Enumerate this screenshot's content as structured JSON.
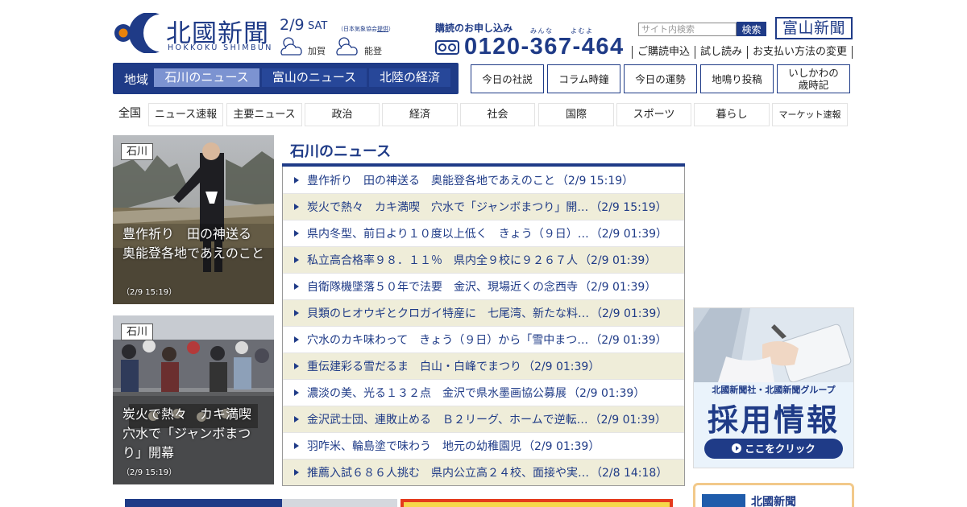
{
  "header": {
    "logo_text": "北國新聞",
    "logo_sub": "HOKKOKU SHIMBUN",
    "weather": {
      "date": "2/9",
      "day": "SAT",
      "source_prefix": "（日本気象協会",
      "source_link": "提供",
      "source_suffix": "）",
      "areas": [
        {
          "label": "加賀",
          "icon": "cloud-sun-icon"
        },
        {
          "label": "能登",
          "icon": "cloud-sun-icon"
        }
      ]
    },
    "subscribe": {
      "title": "購読のお申し込み",
      "phone": "0120-367-464",
      "ruby_minna": "みんな",
      "ruby_yoi": "よむよ"
    },
    "search": {
      "placeholder": "サイト内検索",
      "button": "検索"
    },
    "toyama_logo": "富山新聞",
    "links": [
      "ご購読申込",
      "試し読み",
      "お支払い方法の変更"
    ]
  },
  "region_nav": {
    "label": "地域",
    "tabs": [
      "石川のニュース",
      "富山のニュース",
      "北陸の経済"
    ],
    "active_index": 0
  },
  "box_nav": [
    {
      "label": "今日の社説"
    },
    {
      "label": "コラム時鐘"
    },
    {
      "label": "今日の運勢"
    },
    {
      "label": "地鳴り投稿"
    },
    {
      "label": "いしかわの\n歳時記"
    }
  ],
  "category_nav": {
    "first": "全国",
    "items": [
      "ニュース速報",
      "主要ニュース",
      "政治",
      "経済",
      "社会",
      "国際",
      "スポーツ",
      "暮らし",
      "マーケット速報"
    ]
  },
  "features": [
    {
      "tag": "石川",
      "caption": "豊作祈り　田の神送る\n奥能登各地であえのこと",
      "time": "（2/9 15:19）"
    },
    {
      "tag": "石川",
      "caption": "炭火で熱々　カキ満喫\n穴水で「ジャンボまつ\nり」開幕",
      "time": "（2/9 15:19）"
    }
  ],
  "news": {
    "heading": "石川のニュース",
    "items": [
      {
        "title": "豊作祈り　田の神送る　奥能登各地であえのこと",
        "date": "（2/9 15:19）"
      },
      {
        "title": "炭火で熱々　カキ満喫　穴水で「ジャンボまつり」開…",
        "date": "（2/9 15:19）"
      },
      {
        "title": "県内冬型、前日より１０度以上低く　きょう（９日）…",
        "date": "（2/9 01:39）"
      },
      {
        "title": "私立高合格率９８．１１％　県内全９校に９２６７人",
        "date": "（2/9 01:39）"
      },
      {
        "title": "自衛隊機墜落５０年で法要　金沢、現場近くの念西寺",
        "date": "（2/9 01:39）"
      },
      {
        "title": "貝類のヒオウギとクロガイ特産に　七尾湾、新たな料…",
        "date": "（2/9 01:39）"
      },
      {
        "title": "穴水のカキ味わって　きょう（９日）から「雪中まつ…",
        "date": "（2/9 01:39）"
      },
      {
        "title": "重伝建彩る雪だるま　白山・白峰でまつり",
        "date": "（2/9 01:39）"
      },
      {
        "title": "濃淡の美、光る１３２点　金沢で県水墨画協公募展",
        "date": "（2/9 01:39）"
      },
      {
        "title": "金沢武士団、連敗止める　Ｂ２リーグ、ホームで逆転…",
        "date": "（2/9 01:39）"
      },
      {
        "title": "羽咋米、輪島塗で味わう　地元の幼稚園児",
        "date": "（2/9 01:39）"
      },
      {
        "title": "推薦入試６８６人挑む　県内公立高２４校、面接や実…",
        "date": "（2/8 14:18）"
      }
    ]
  },
  "recruit_banner": {
    "group": "北國新聞社・北國新聞グループ",
    "title": "採用情報",
    "button": "ここをクリック"
  },
  "paper_box": {
    "name": "北國新聞"
  },
  "colors": {
    "brand": "#1f3b87",
    "active_tab": "#7c93d1",
    "stripe": "#efedd9",
    "recruit_border": "#f2c98a"
  }
}
